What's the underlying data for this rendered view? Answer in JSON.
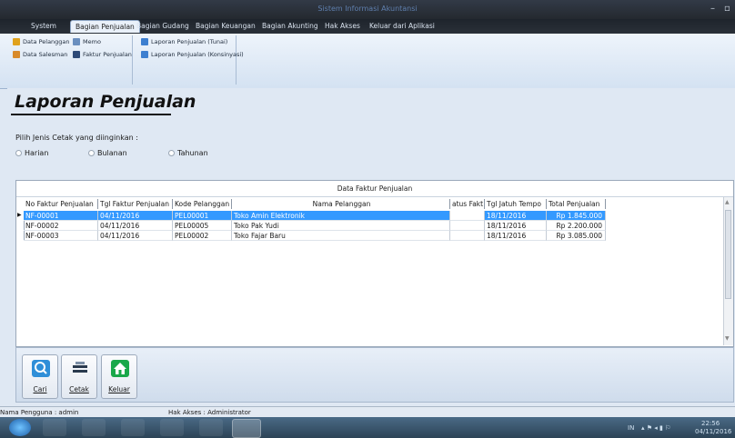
{
  "window": {
    "title": "Sistem Informasi Akuntansi",
    "controls": [
      "–",
      "▫"
    ]
  },
  "menu": {
    "tabs": [
      "System",
      "Bagian Penjualan",
      "Bagian Gudang",
      "Bagian Keuangan",
      "Bagian Akunting",
      "Hak Akses",
      "Keluar dari Aplikasi"
    ]
  },
  "ribbon": {
    "buttons": [
      "Data Pelanggan",
      "Memo",
      "Laporan Penjualan (Tunai)",
      "Data Salesman",
      "Faktur Penjualan",
      "Laporan Penjualan (Konsinyasi)"
    ]
  },
  "page": {
    "heading": "Laporan Penjualan",
    "prompt": "Pilih Jenis Cetak yang diinginkan :"
  },
  "radios": [
    "Harian",
    "Bulanan",
    "Tahunan"
  ],
  "grid": {
    "caption": "Data Faktur Penjualan",
    "columns": [
      "No Faktur Penjualan",
      "Tgl Faktur Penjualan",
      "Kode Pelanggan",
      "Nama Pelanggan",
      "atus Fakt",
      "Tgl Jatuh Tempo",
      "Total Penjualan"
    ],
    "rows": [
      [
        "NF-00001",
        "04/11/2016",
        "PEL00001",
        "Toko Amin Elektronik",
        "",
        "18/11/2016",
        "Rp 1.845.000"
      ],
      [
        "NF-00002",
        "04/11/2016",
        "PEL00005",
        "Toko Pak Yudi",
        "",
        "18/11/2016",
        "Rp 2.200.000"
      ],
      [
        "NF-00003",
        "04/11/2016",
        "PEL00002",
        "Toko Fajar Baru",
        "",
        "18/11/2016",
        "Rp 3.085.000"
      ]
    ]
  },
  "actions": {
    "cari": "Cari",
    "cetak": "Cetak",
    "keluar": "Keluar"
  },
  "status": {
    "user": "Nama Pengguna : admin",
    "access": "Hak Akses :   Administrator"
  },
  "taskbar": {
    "lang": "IN",
    "time": "22:56",
    "date": "04/11/2016"
  }
}
